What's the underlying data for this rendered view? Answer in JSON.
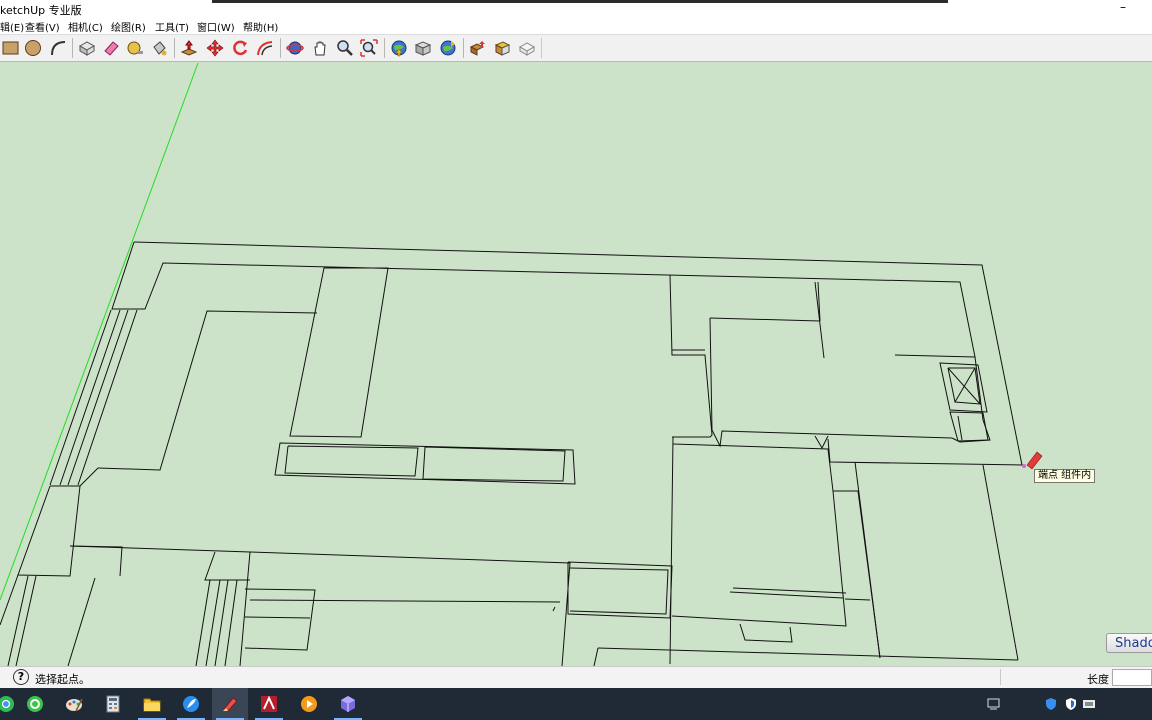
{
  "window": {
    "title": "ketchUp 专业版",
    "minimize_glyph": "–"
  },
  "menu": [
    {
      "label": "辑(E)"
    },
    {
      "label": "查看(V)"
    },
    {
      "label": "相机(C)"
    },
    {
      "label": "绘图(R)"
    },
    {
      "label": "工具(T)"
    },
    {
      "label": "窗口(W)"
    },
    {
      "label": "帮助(H)"
    }
  ],
  "toolbar": {
    "tools": [
      {
        "icon": "rectangle-icon"
      },
      {
        "icon": "circle-icon"
      },
      {
        "icon": "arc-icon"
      },
      {
        "icon": "make-component-icon"
      },
      {
        "icon": "eraser-icon"
      },
      {
        "icon": "tape-measure-icon"
      },
      {
        "icon": "paint-bucket-icon"
      },
      {
        "icon": "push-pull-icon"
      },
      {
        "icon": "move-icon"
      },
      {
        "icon": "rotate-icon"
      },
      {
        "icon": "offset-icon"
      },
      {
        "icon": "orbit-icon"
      },
      {
        "icon": "pan-icon"
      },
      {
        "icon": "zoom-icon"
      },
      {
        "icon": "zoom-extents-icon"
      },
      {
        "icon": "get-models-icon"
      },
      {
        "icon": "share-model-icon"
      },
      {
        "icon": "share-component-icon"
      },
      {
        "icon": "extension-warehouse-icon"
      },
      {
        "icon": "layout-icon"
      },
      {
        "icon": "style-builder-icon"
      }
    ]
  },
  "viewport": {
    "background_color": "#cde3c9",
    "axis_color": "#22dd22",
    "line_color": "#111111",
    "inference_tooltip": "端点 组件内",
    "shadow_tab_label": "Shado"
  },
  "statusbar": {
    "status_text": "选择起点。",
    "length_label": "长度",
    "length_value": ""
  },
  "taskbar": {
    "apps": [
      {
        "icon": "chrome-icon"
      },
      {
        "icon": "green-app-icon"
      },
      {
        "icon": "paint-icon"
      },
      {
        "icon": "calculator-icon"
      },
      {
        "icon": "file-explorer-icon"
      },
      {
        "icon": "feather-app-icon"
      },
      {
        "icon": "sketchup-icon"
      },
      {
        "icon": "autocad-icon"
      },
      {
        "icon": "orange-app-icon"
      },
      {
        "icon": "cube-app-icon"
      }
    ],
    "tray": [
      {
        "icon": "notification-icon"
      },
      {
        "icon": "security-icon"
      },
      {
        "icon": "shield-icon"
      },
      {
        "icon": "keyboard-icon"
      }
    ]
  }
}
